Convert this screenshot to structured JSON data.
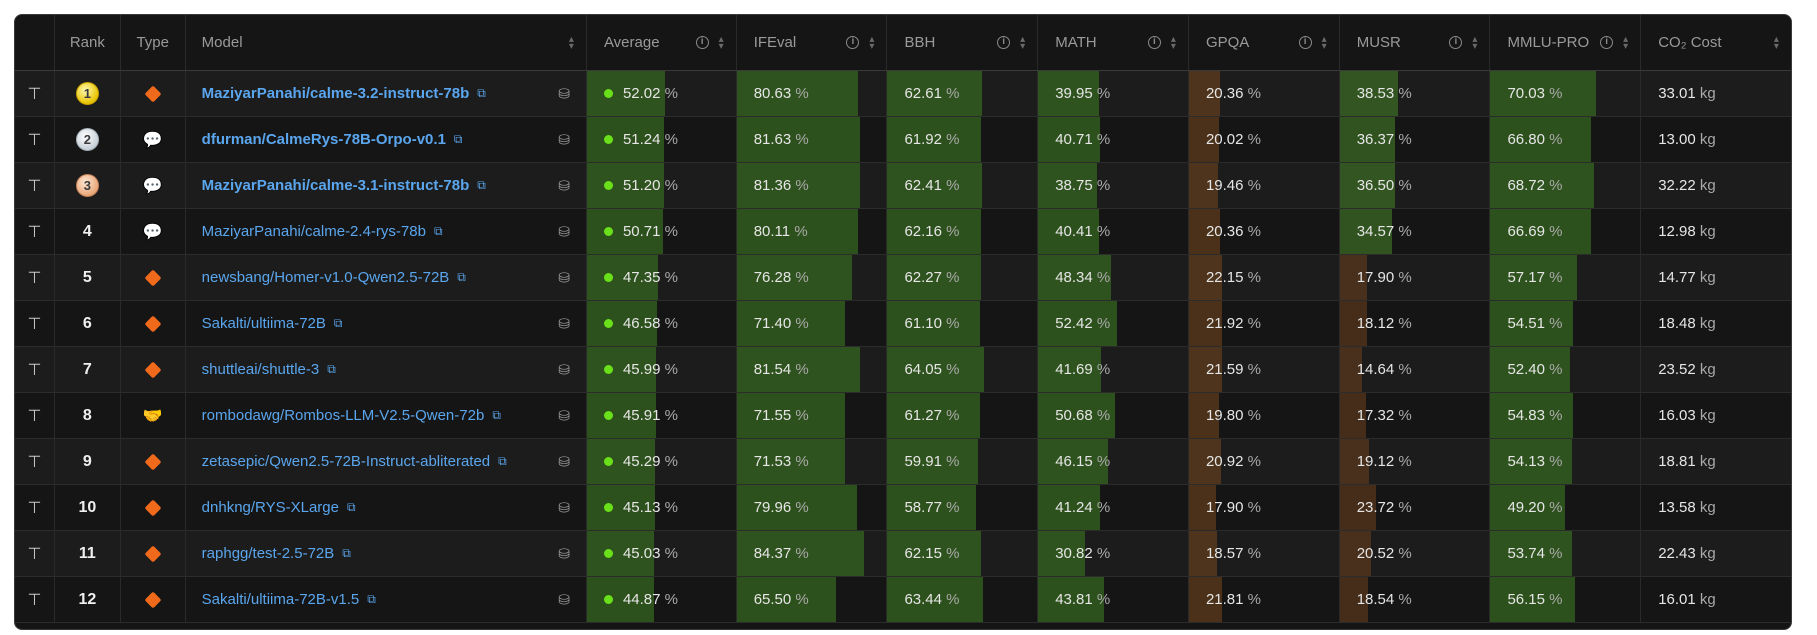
{
  "columns": {
    "rank": "Rank",
    "type": "Type",
    "model": "Model",
    "average": "Average",
    "ifeval": "IFEval",
    "bbh": "BBH",
    "math": "MATH",
    "gpqa": "GPQA",
    "musr": "MUSR",
    "mmlu_pro": "MMLU-PRO",
    "co2": "CO₂ Cost"
  },
  "icons": {
    "pin": "pin-icon",
    "info": "info-icon",
    "sort": "sort-icon",
    "external": "external-link-icon",
    "database": "database-icon"
  },
  "colors": {
    "link": "#5aa6ee",
    "avg_dot": "#69e01a",
    "bar_green": "#2f5a1c",
    "bar_brown": "#4a3018",
    "type_pretrained": "#f06a1c"
  },
  "rows": [
    {
      "rank": "1",
      "medal": "gold",
      "type": "diamond",
      "model": "MaziyarPanahi/calme-3.2-instruct-78b",
      "bold": true,
      "average": "52.02",
      "ifeval": "80.63",
      "bbh": "62.61",
      "math": "39.95",
      "gpqa": "20.36",
      "musr": "38.53",
      "mmlu_pro": "70.03",
      "co2": "33.01"
    },
    {
      "rank": "2",
      "medal": "silver",
      "type": "chat",
      "model": "dfurman/CalmeRys-78B-Orpo-v0.1",
      "bold": true,
      "average": "51.24",
      "ifeval": "81.63",
      "bbh": "61.92",
      "math": "40.71",
      "gpqa": "20.02",
      "musr": "36.37",
      "mmlu_pro": "66.80",
      "co2": "13.00"
    },
    {
      "rank": "3",
      "medal": "bronze",
      "type": "chat",
      "model": "MaziyarPanahi/calme-3.1-instruct-78b",
      "bold": true,
      "average": "51.20",
      "ifeval": "81.36",
      "bbh": "62.41",
      "math": "38.75",
      "gpqa": "19.46",
      "musr": "36.50",
      "mmlu_pro": "68.72",
      "co2": "32.22"
    },
    {
      "rank": "4",
      "medal": "",
      "type": "chat",
      "model": "MaziyarPanahi/calme-2.4-rys-78b",
      "bold": false,
      "average": "50.71",
      "ifeval": "80.11",
      "bbh": "62.16",
      "math": "40.41",
      "gpqa": "20.36",
      "musr": "34.57",
      "mmlu_pro": "66.69",
      "co2": "12.98"
    },
    {
      "rank": "5",
      "medal": "",
      "type": "diamond",
      "model": "newsbang/Homer-v1.0-Qwen2.5-72B",
      "bold": false,
      "average": "47.35",
      "ifeval": "76.28",
      "bbh": "62.27",
      "math": "48.34",
      "gpqa": "22.15",
      "musr": "17.90",
      "mmlu_pro": "57.17",
      "co2": "14.77"
    },
    {
      "rank": "6",
      "medal": "",
      "type": "diamond",
      "model": "Sakalti/ultiima-72B",
      "bold": false,
      "average": "46.58",
      "ifeval": "71.40",
      "bbh": "61.10",
      "math": "52.42",
      "gpqa": "21.92",
      "musr": "18.12",
      "mmlu_pro": "54.51",
      "co2": "18.48"
    },
    {
      "rank": "7",
      "medal": "",
      "type": "diamond",
      "model": "shuttleai/shuttle-3",
      "bold": false,
      "average": "45.99",
      "ifeval": "81.54",
      "bbh": "64.05",
      "math": "41.69",
      "gpqa": "21.59",
      "musr": "14.64",
      "mmlu_pro": "52.40",
      "co2": "23.52"
    },
    {
      "rank": "8",
      "medal": "",
      "type": "merge",
      "model": "rombodawg/Rombos-LLM-V2.5-Qwen-72b",
      "bold": false,
      "average": "45.91",
      "ifeval": "71.55",
      "bbh": "61.27",
      "math": "50.68",
      "gpqa": "19.80",
      "musr": "17.32",
      "mmlu_pro": "54.83",
      "co2": "16.03"
    },
    {
      "rank": "9",
      "medal": "",
      "type": "diamond",
      "model": "zetasepic/Qwen2.5-72B-Instruct-abliterated",
      "bold": false,
      "average": "45.29",
      "ifeval": "71.53",
      "bbh": "59.91",
      "math": "46.15",
      "gpqa": "20.92",
      "musr": "19.12",
      "mmlu_pro": "54.13",
      "co2": "18.81"
    },
    {
      "rank": "10",
      "medal": "",
      "type": "diamond",
      "model": "dnhkng/RYS-XLarge",
      "bold": false,
      "average": "45.13",
      "ifeval": "79.96",
      "bbh": "58.77",
      "math": "41.24",
      "gpqa": "17.90",
      "musr": "23.72",
      "mmlu_pro": "49.20",
      "co2": "13.58"
    },
    {
      "rank": "11",
      "medal": "",
      "type": "diamond",
      "model": "raphgg/test-2.5-72B",
      "bold": false,
      "average": "45.03",
      "ifeval": "84.37",
      "bbh": "62.15",
      "math": "30.82",
      "gpqa": "18.57",
      "musr": "20.52",
      "mmlu_pro": "53.74",
      "co2": "22.43"
    },
    {
      "rank": "12",
      "medal": "",
      "type": "diamond",
      "model": "Sakalti/ultiima-72B-v1.5",
      "bold": false,
      "average": "44.87",
      "ifeval": "65.50",
      "bbh": "63.44",
      "math": "43.81",
      "gpqa": "21.81",
      "musr": "18.54",
      "mmlu_pro": "56.15",
      "co2": "16.01"
    }
  ],
  "units": {
    "percent": "%",
    "co2": "kg"
  }
}
